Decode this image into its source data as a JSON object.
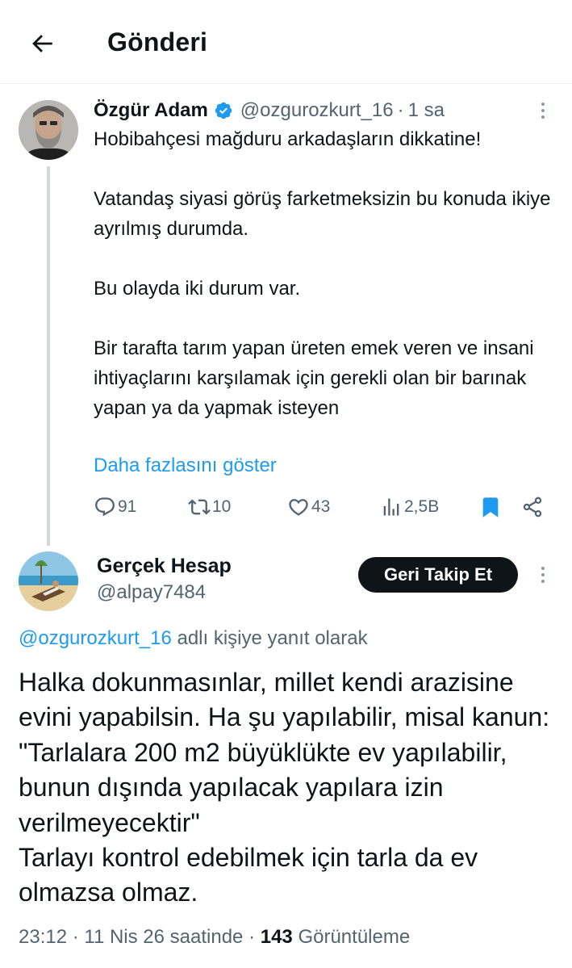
{
  "header": {
    "title": "Gönderi"
  },
  "parent": {
    "name": "Özgür Adam",
    "handle": "@ozgurozkurt_16",
    "separator": "·",
    "time": "1 sa",
    "paragraphs": [
      "Hobibahçesi mağduru arkadaşların dikkatine!",
      "Vatandaş siyasi görüş farketmeksizin bu konuda ikiye ayrılmış durumda.",
      "Bu olayda iki durum var.",
      "Bir tarafta tarım yapan üreten emek veren ve insani ihtiyaçlarını karşılamak için gerekli olan bir barınak yapan ya da yapmak isteyen"
    ],
    "show_more": "Daha fazlasını göster",
    "actions": {
      "replies": "91",
      "reposts": "10",
      "likes": "43",
      "views": "2,5B"
    }
  },
  "reply": {
    "name": "Gerçek Hesap",
    "handle": "@alpay7484",
    "follow_label": "Geri Takip Et",
    "context_mention": "@ozgurozkurt_16",
    "context_suffix": " adlı kişiye yanıt olarak",
    "lines": [
      "Halka dokunmasınlar, millet kendi arazisine evini yapabilsin. Ha şu yapılabilir, misal kanun: \"Tarlalara 200 m2 büyüklükte ev yapılabilir, bunun dışında yapılacak yapılara izin verilmeyecektir\"",
      "Tarlayı kontrol edebilmek için tarla da ev olmazsa olmaz."
    ],
    "meta": {
      "time": "23:12",
      "dot1": " · ",
      "date": "11 Nis 26 saatinde",
      "dot2": " · ",
      "views": "143",
      "views_label": " Görüntüleme"
    }
  },
  "colors": {
    "accent": "#1d9bf0",
    "muted": "#536471",
    "text": "#0f1419",
    "line": "#cfd9de"
  },
  "icons": [
    "back-arrow-icon",
    "verified-badge-icon",
    "more-icon",
    "reply-icon",
    "repost-icon",
    "like-icon",
    "views-icon",
    "bookmark-icon",
    "share-icon"
  ]
}
